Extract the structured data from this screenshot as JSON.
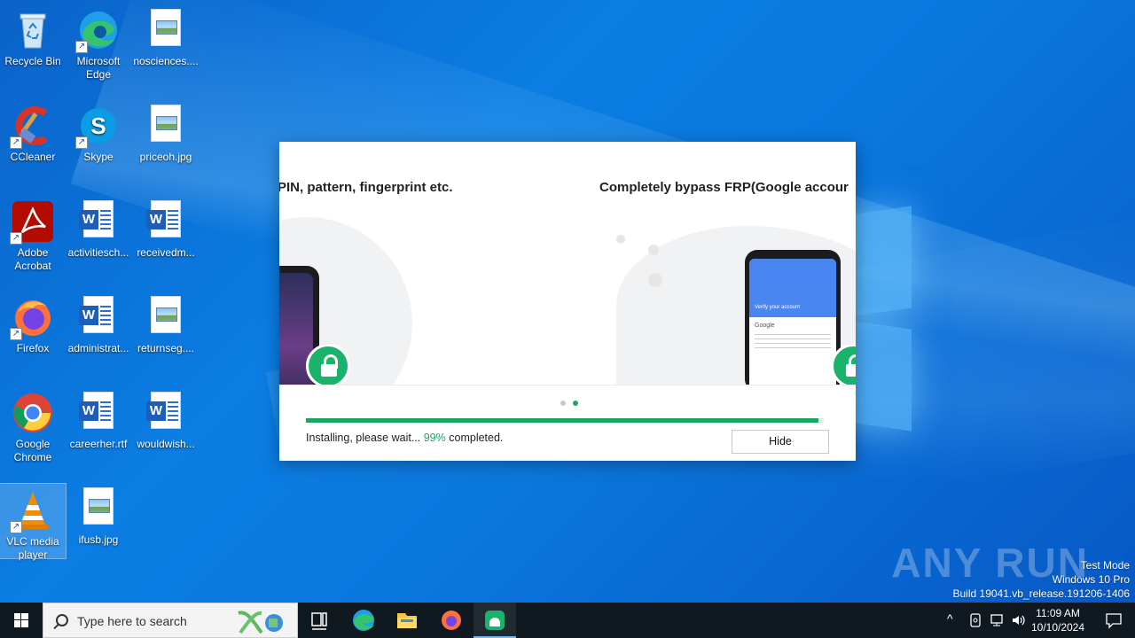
{
  "desktop": {
    "icons": [
      {
        "label": "Recycle Bin"
      },
      {
        "label": "Microsoft Edge"
      },
      {
        "label": "nosciences...."
      },
      {
        "label": "CCleaner"
      },
      {
        "label": "Skype"
      },
      {
        "label": "priceoh.jpg"
      },
      {
        "label": "Adobe Acrobat"
      },
      {
        "label": "activitiesch..."
      },
      {
        "label": "receivedm..."
      },
      {
        "label": "Firefox"
      },
      {
        "label": "administrat..."
      },
      {
        "label": "returnseg...."
      },
      {
        "label": "Google Chrome"
      },
      {
        "label": "careerher.rtf"
      },
      {
        "label": "wouldwish..."
      },
      {
        "label": "VLC media player"
      },
      {
        "label": "ifusb.jpg"
      }
    ]
  },
  "installer": {
    "slide_left_title": "PIN, pattern, fingerprint etc.",
    "slide_right_title": "Completely bypass FRP(Google accour",
    "phone_screen_header": "Verify your account",
    "phone_screen_brand": "Google",
    "status_prefix": "Installing, please wait...",
    "progress_percent_text": "99%",
    "status_suffix": "completed.",
    "progress_value": 0.99,
    "hide_label": "Hide",
    "active_slide_index": 1,
    "colors": {
      "accent": "#1aa764",
      "dot_inactive": "#c8c8c8"
    }
  },
  "watermark": {
    "brand": "ANY RUN",
    "line1": "Test Mode",
    "line2": "Windows 10 Pro",
    "line3": "Build 19041.vb_release.191206-1406"
  },
  "taskbar": {
    "search_placeholder": "Type here to search",
    "time": "11:09 AM",
    "date": "10/10/2024"
  }
}
